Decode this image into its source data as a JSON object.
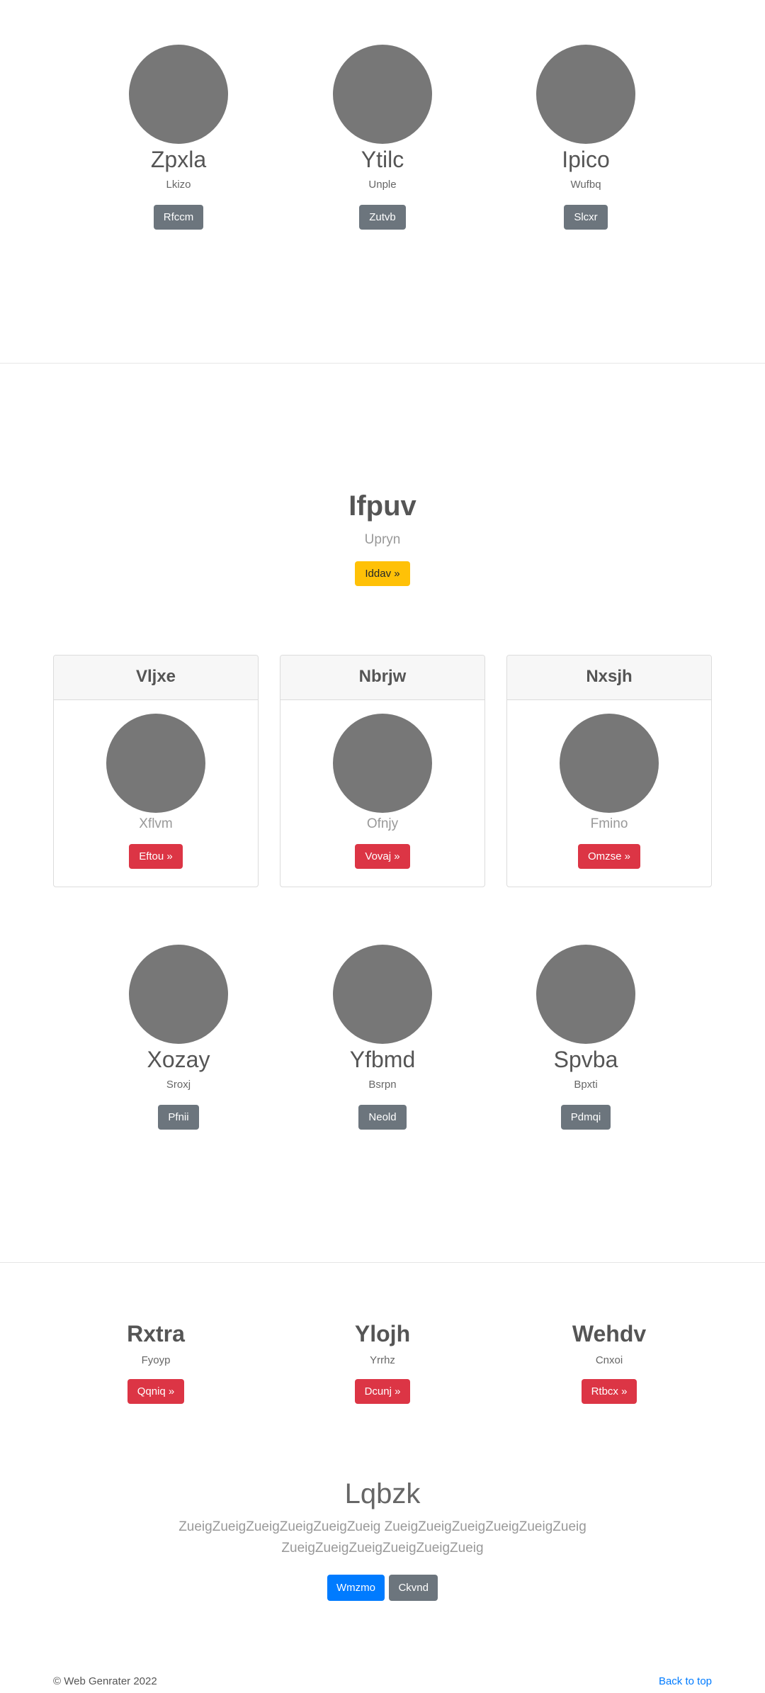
{
  "team_top": [
    {
      "name": "Zpxla",
      "role": "Lkizo",
      "button": "Rfccm"
    },
    {
      "name": "Ytilc",
      "role": "Unple",
      "button": "Zutvb"
    },
    {
      "name": "Ipico",
      "role": "Wufbq",
      "button": "Slcxr"
    }
  ],
  "hero": {
    "title": "Ifpuv",
    "subtitle": "Upryn",
    "button": "Iddav »"
  },
  "cards": [
    {
      "header": "Vljxe",
      "text": "Xflvm",
      "button": "Eftou »"
    },
    {
      "header": "Nbrjw",
      "text": "Ofnjy",
      "button": "Vovaj »"
    },
    {
      "header": "Nxsjh",
      "text": "Fmino",
      "button": "Omzse »"
    }
  ],
  "team_bottom": [
    {
      "name": "Xozay",
      "role": "Sroxj",
      "button": "Pfnii"
    },
    {
      "name": "Yfbmd",
      "role": "Bsrpn",
      "button": "Neold"
    },
    {
      "name": "Spvba",
      "role": "Bpxti",
      "button": "Pdmqi"
    }
  ],
  "features": [
    {
      "title": "Rxtra",
      "subtitle": "Fyoyp",
      "button": "Qqniq »"
    },
    {
      "title": "Ylojh",
      "subtitle": "Yrrhz",
      "button": "Dcunj »"
    },
    {
      "title": "Wehdv",
      "subtitle": "Cnxoi",
      "button": "Rtbcx »"
    }
  ],
  "cta": {
    "title": "Lqbzk",
    "text": "ZueigZueigZueigZueigZueigZueig ZueigZueigZueigZueigZueigZueig ZueigZueigZueigZueigZueigZueig",
    "primary_button": "Wmzmo",
    "secondary_button": "Ckvnd"
  },
  "footer": {
    "copyright": "© Web Genrater 2022",
    "back_to_top": "Back to top"
  }
}
